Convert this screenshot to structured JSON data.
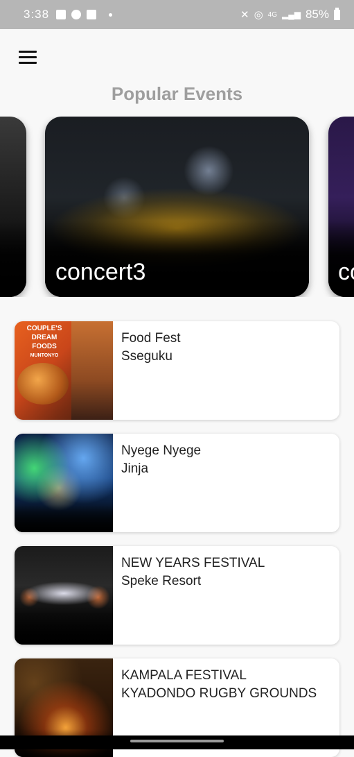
{
  "status_bar": {
    "time": "3:38",
    "battery": "85%",
    "network": "4G"
  },
  "app_bar": {
    "menu_icon": "hamburger-menu-icon"
  },
  "popular": {
    "title": "Popular Events",
    "cards": [
      {
        "title": ""
      },
      {
        "title": "concert3"
      },
      {
        "title": "co"
      }
    ]
  },
  "events": [
    {
      "name": "Food Fest",
      "place": "Sseguku"
    },
    {
      "name": "Nyege Nyege",
      "place": "Jinja"
    },
    {
      "name": "NEW YEARS FESTIVAL",
      "place": "Speke Resort"
    },
    {
      "name": "KAMPALA FESTIVAL",
      "place": "KYADONDO RUGBY GROUNDS"
    }
  ],
  "food_poster": {
    "line1": "COUPLE'S",
    "line2": "DREAM",
    "line3": "FOODS",
    "line4": "MUNTONYO"
  },
  "colors": {
    "status_bar_bg": "#b6b6b6",
    "page_bg": "#f8f8f8",
    "section_title": "#9e9e9e"
  }
}
